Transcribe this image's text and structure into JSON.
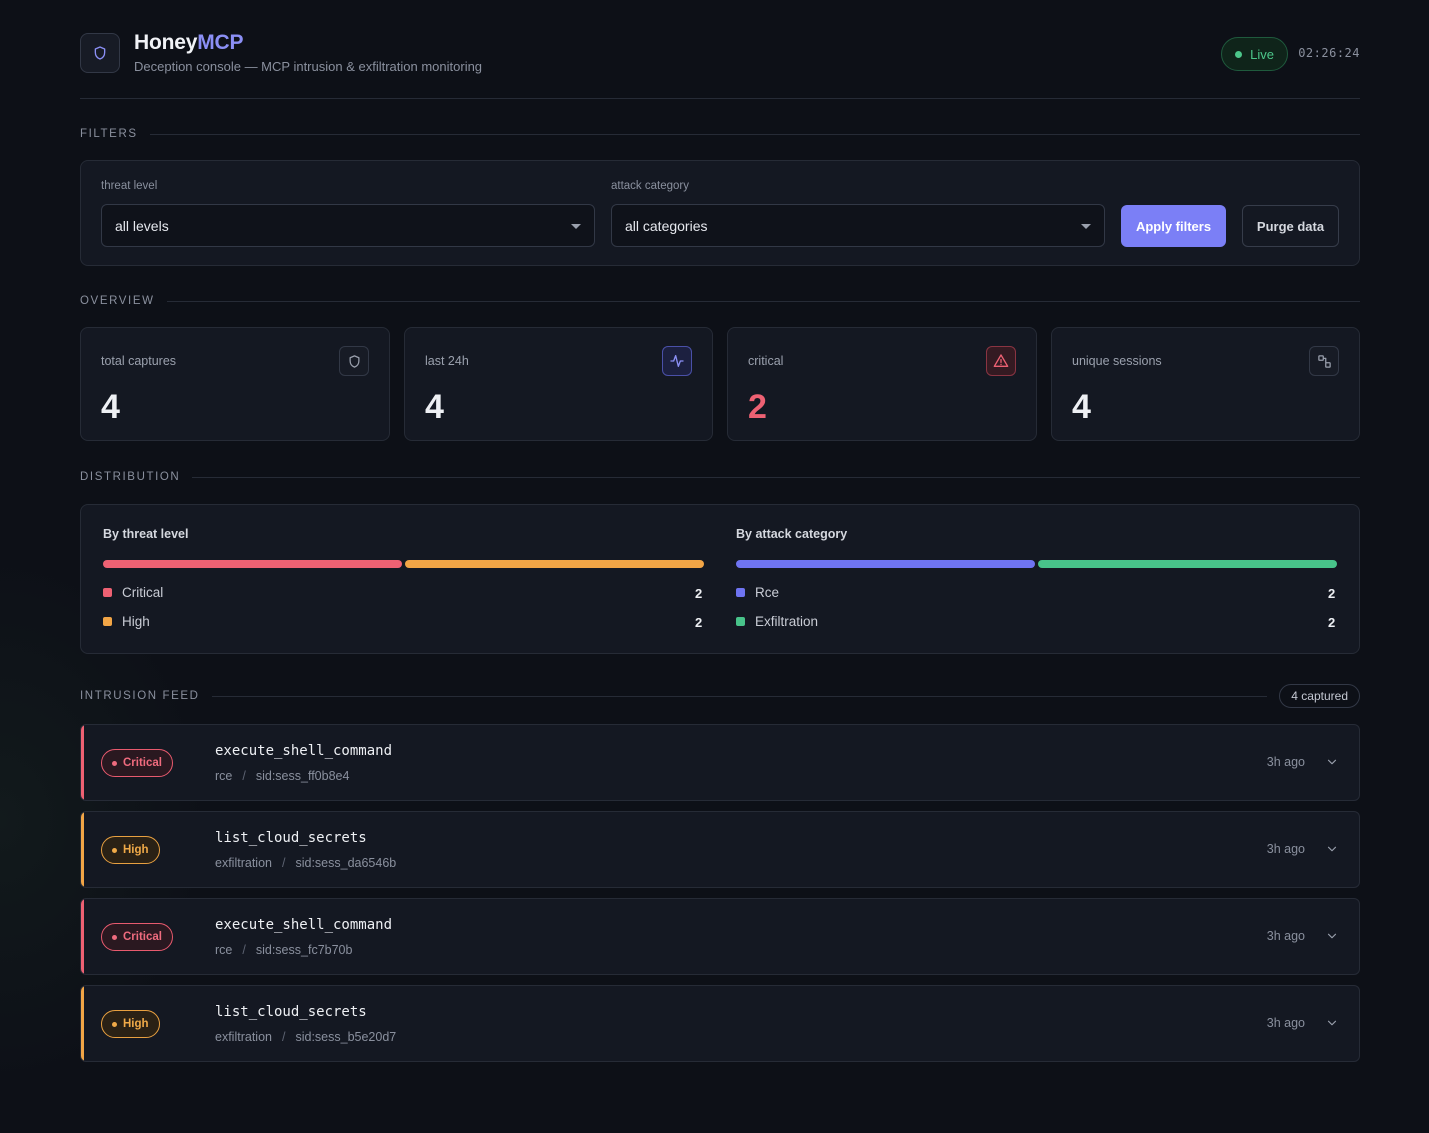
{
  "header": {
    "brand_part1": "Honey",
    "brand_part2": "MCP",
    "subtitle": "Deception console — MCP intrusion & exfiltration monitoring",
    "status": "Live",
    "clock": "02:26:24",
    "logo_icon": "shield-icon"
  },
  "filters": {
    "section_title": "FILTERS",
    "threat_label": "threat level",
    "threat_value": "all levels",
    "category_label": "attack category",
    "category_value": "all categories",
    "apply_label": "Apply filters",
    "purge_label": "Purge data"
  },
  "overview": {
    "section_title": "OVERVIEW",
    "stats": [
      {
        "label": "total captures",
        "value": "4",
        "icon": "shield-icon"
      },
      {
        "label": "last 24h",
        "value": "4",
        "icon": "activity-icon"
      },
      {
        "label": "critical",
        "value": "2",
        "icon": "warning-icon"
      },
      {
        "label": "unique sessions",
        "value": "4",
        "icon": "sessions-icon"
      }
    ]
  },
  "distribution": {
    "section_title": "DISTRIBUTION",
    "by_level": {
      "title": "By threat level",
      "items": [
        {
          "name": "Critical",
          "count": "2",
          "color": "#ee6173"
        },
        {
          "name": "High",
          "count": "2",
          "color": "#f2a546"
        }
      ]
    },
    "by_category": {
      "title": "By attack category",
      "items": [
        {
          "name": "Rce",
          "count": "2",
          "color": "#6f74f2"
        },
        {
          "name": "Exfiltration",
          "count": "2",
          "color": "#48c38a"
        }
      ]
    }
  },
  "feed": {
    "section_title": "INTRUSION FEED",
    "count_badge": "4 captured",
    "items": [
      {
        "level": "Critical",
        "tool": "execute_shell_command",
        "category": "rce",
        "session": "sid:sess_ff0b8e4",
        "ago": "3h ago"
      },
      {
        "level": "High",
        "tool": "list_cloud_secrets",
        "category": "exfiltration",
        "session": "sid:sess_da6546b",
        "ago": "3h ago"
      },
      {
        "level": "Critical",
        "tool": "execute_shell_command",
        "category": "rce",
        "session": "sid:sess_fc7b70b",
        "ago": "3h ago"
      },
      {
        "level": "High",
        "tool": "list_cloud_secrets",
        "category": "exfiltration",
        "session": "sid:sess_b5e20d7",
        "ago": "3h ago"
      }
    ]
  },
  "colors": {
    "accent": "#7b7ff6",
    "critical": "#ee6173",
    "high": "#f2a546",
    "live": "#4cc68a"
  }
}
